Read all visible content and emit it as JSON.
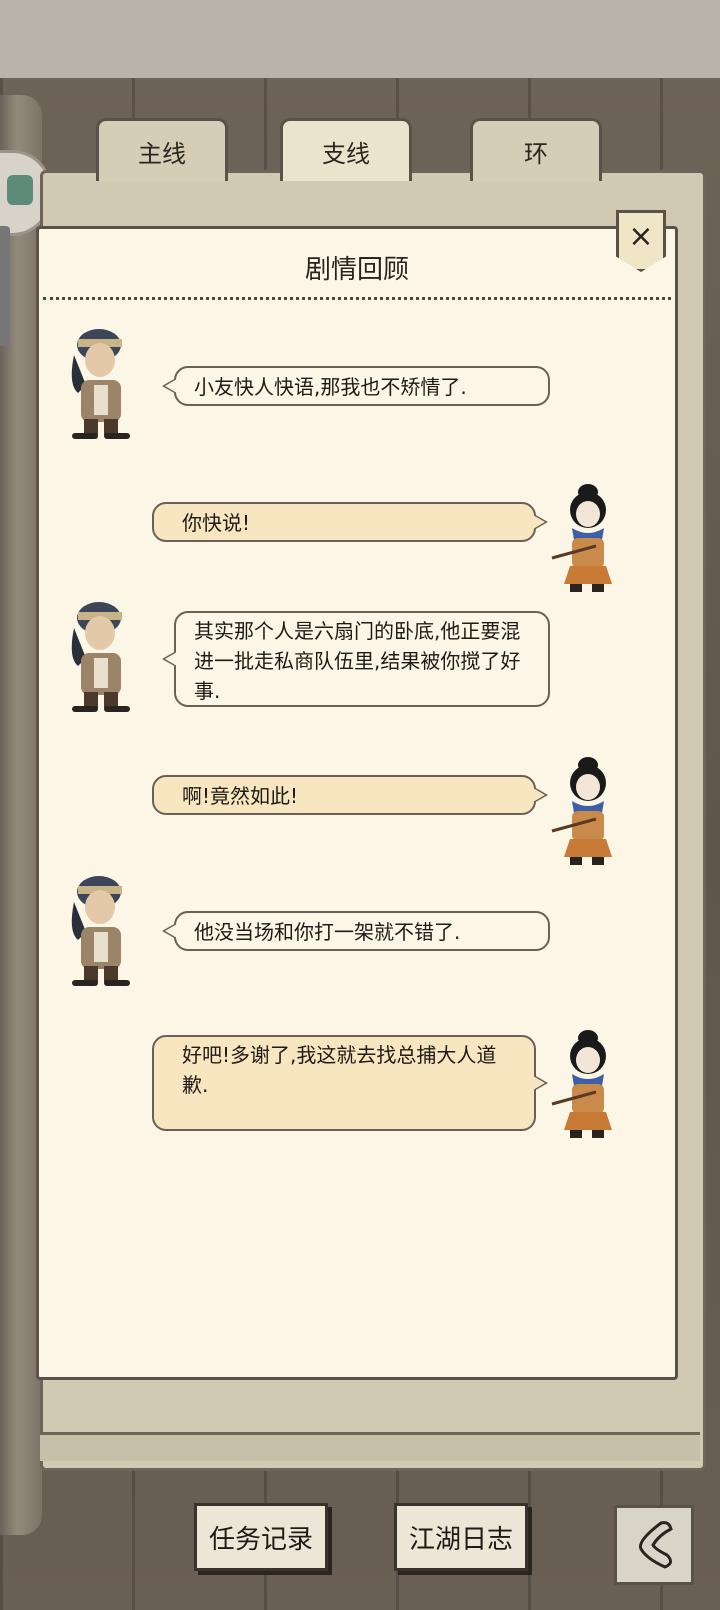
{
  "tabs": [
    {
      "label": "主线"
    },
    {
      "label": "支线"
    },
    {
      "label": "环"
    }
  ],
  "panel": {
    "title": "剧情回顾",
    "close_label": "×"
  },
  "dialogue": [
    {
      "speaker": "elder",
      "side": "left",
      "text": "小友快人快语,那我也不矫情了."
    },
    {
      "speaker": "heroine",
      "side": "right",
      "text": "你快说!"
    },
    {
      "speaker": "elder",
      "side": "left",
      "text": "其实那个人是六扇门的卧底,他正要混进一批走私商队伍里,结果被你搅了好事."
    },
    {
      "speaker": "heroine",
      "side": "right",
      "text": "啊!竟然如此!"
    },
    {
      "speaker": "elder",
      "side": "left",
      "text": "他没当场和你打一架就不错了."
    },
    {
      "speaker": "heroine",
      "side": "right",
      "text": "好吧!多谢了,我这就去找总捕大人道歉."
    }
  ],
  "bottom": {
    "quest_log_label": "任务记录",
    "jianghu_diary_label": "江湖日志"
  },
  "colors": {
    "paper": "#fbf6e6",
    "bubble_right": "#f8e6c0",
    "ink": "#1f1a16",
    "wood": "#5f564c"
  }
}
